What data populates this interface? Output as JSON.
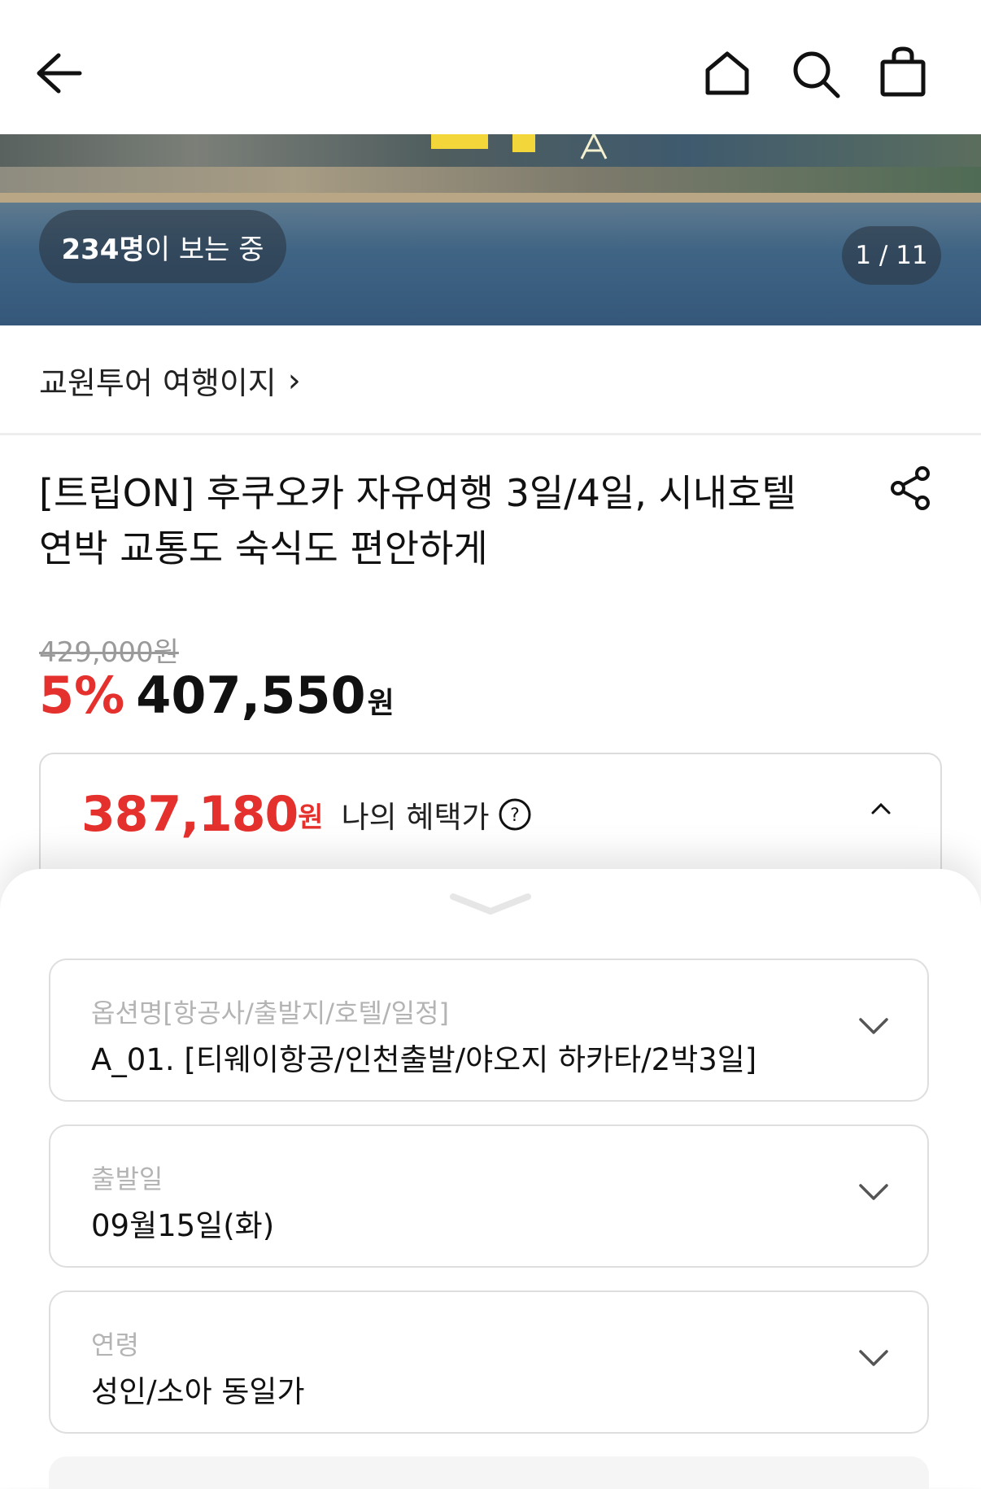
{
  "header": {
    "back_icon": "arrow-left-icon",
    "home_icon": "home-icon",
    "search_icon": "search-icon",
    "cart_icon": "shopping-bag-icon"
  },
  "hero": {
    "viewers_count": "234명",
    "viewers_suffix": "이 보는 중",
    "counter": "1 / 11"
  },
  "seller": {
    "name": "교원투어 여행이지",
    "chevron": "›"
  },
  "product": {
    "title": "[트립ON] 후쿠오카 자유여행 3일/4일, 시내호텔 연박 교통도 숙식도 편안하게",
    "original_price": "429,000원",
    "discount": "5%",
    "price": "407,550",
    "price_unit": "원"
  },
  "benefit": {
    "price": "387,180",
    "price_unit": "원",
    "label": "나의 혜택가"
  },
  "options": [
    {
      "label": "옵션명[항공사/출발지/호텔/일정]",
      "value": "A_01. [티웨이항공/인천출발/야오지 하카타/2박3일]"
    },
    {
      "label": "출발일",
      "value": "09월15일(화)"
    },
    {
      "label": "연령",
      "value": "성인/소아 동일가"
    }
  ],
  "colors": {
    "accent": "#e5312d"
  }
}
